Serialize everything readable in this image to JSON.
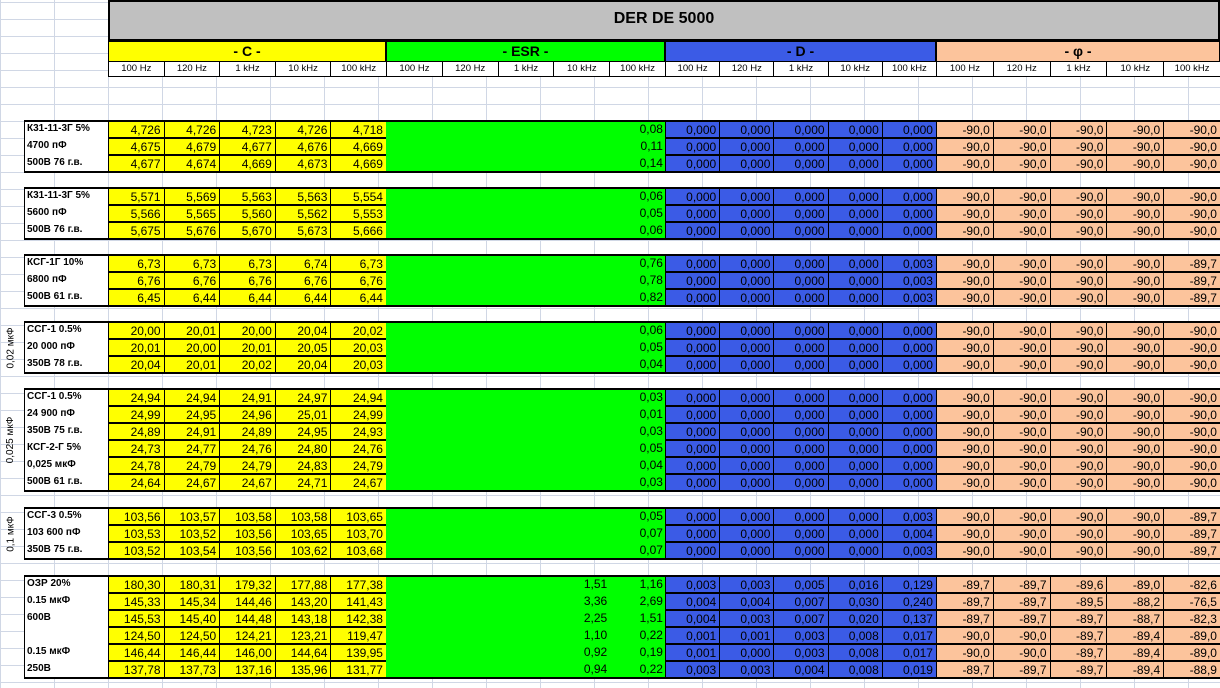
{
  "title": "DER DE 5000",
  "groups": [
    {
      "name": "- C -",
      "color": "#ffff00"
    },
    {
      "name": "- ESR -",
      "color": "#00ff00"
    },
    {
      "name": "- D -",
      "color": "#3b5be6"
    },
    {
      "name": "- φ -",
      "color": "#fcc49c"
    }
  ],
  "frequencies": [
    "100 Hz",
    "120 Hz",
    "1 kHz",
    "10 kHz",
    "100 kHz"
  ],
  "side_labels": [
    "0,02 мкФ",
    "0,025 мкФ",
    "0,1 мкФ"
  ],
  "rows": [
    {
      "label": "К31-11-3Г 5%",
      "c": [
        "4,726",
        "4,726",
        "4,723",
        "4,726",
        "4,718"
      ],
      "esr": [
        "",
        "",
        "",
        "",
        "0,08"
      ],
      "d": [
        "0,000",
        "0,000",
        "0,000",
        "0,000",
        "0,000"
      ],
      "phi": [
        "-90,0",
        "-90,0",
        "-90,0",
        "-90,0",
        "-90,0"
      ]
    },
    {
      "label": "4700 пФ",
      "c": [
        "4,675",
        "4,679",
        "4,677",
        "4,676",
        "4,669"
      ],
      "esr": [
        "",
        "",
        "",
        "",
        "0,11"
      ],
      "d": [
        "0,000",
        "0,000",
        "0,000",
        "0,000",
        "0,000"
      ],
      "phi": [
        "-90,0",
        "-90,0",
        "-90,0",
        "-90,0",
        "-90,0"
      ]
    },
    {
      "label": "500В 76 г.в.",
      "c": [
        "4,677",
        "4,674",
        "4,669",
        "4,673",
        "4,669"
      ],
      "esr": [
        "",
        "",
        "",
        "",
        "0,14"
      ],
      "d": [
        "0,000",
        "0,000",
        "0,000",
        "0,000",
        "0,000"
      ],
      "phi": [
        "-90,0",
        "-90,0",
        "-90,0",
        "-90,0",
        "-90,0"
      ]
    },
    {
      "label": "К31-11-3Г 5%",
      "c": [
        "5,571",
        "5,569",
        "5,563",
        "5,563",
        "5,554"
      ],
      "esr": [
        "",
        "",
        "",
        "",
        "0,06"
      ],
      "d": [
        "0,000",
        "0,000",
        "0,000",
        "0,000",
        "0,000"
      ],
      "phi": [
        "-90,0",
        "-90,0",
        "-90,0",
        "-90,0",
        "-90,0"
      ]
    },
    {
      "label": "5600 пФ",
      "c": [
        "5,566",
        "5,565",
        "5,560",
        "5,562",
        "5,553"
      ],
      "esr": [
        "",
        "",
        "",
        "",
        "0,05"
      ],
      "d": [
        "0,000",
        "0,000",
        "0,000",
        "0,000",
        "0,000"
      ],
      "phi": [
        "-90,0",
        "-90,0",
        "-90,0",
        "-90,0",
        "-90,0"
      ]
    },
    {
      "label": "500В 76 г.в.",
      "c": [
        "5,675",
        "5,676",
        "5,670",
        "5,673",
        "5,666"
      ],
      "esr": [
        "",
        "",
        "",
        "",
        "0,06"
      ],
      "d": [
        "0,000",
        "0,000",
        "0,000",
        "0,000",
        "0,000"
      ],
      "phi": [
        "-90,0",
        "-90,0",
        "-90,0",
        "-90,0",
        "-90,0"
      ]
    },
    {
      "label": "КСГ-1Г 10%",
      "c": [
        "6,73",
        "6,73",
        "6,73",
        "6,74",
        "6,73"
      ],
      "esr": [
        "",
        "",
        "",
        "",
        "0,76"
      ],
      "d": [
        "0,000",
        "0,000",
        "0,000",
        "0,000",
        "0,003"
      ],
      "phi": [
        "-90,0",
        "-90,0",
        "-90,0",
        "-90,0",
        "-89,7"
      ]
    },
    {
      "label": "6800 пФ",
      "c": [
        "6,76",
        "6,76",
        "6,76",
        "6,76",
        "6,76"
      ],
      "esr": [
        "",
        "",
        "",
        "",
        "0,78"
      ],
      "d": [
        "0,000",
        "0,000",
        "0,000",
        "0,000",
        "0,003"
      ],
      "phi": [
        "-90,0",
        "-90,0",
        "-90,0",
        "-90,0",
        "-89,7"
      ]
    },
    {
      "label": "500В 61 г.в.",
      "c": [
        "6,45",
        "6,44",
        "6,44",
        "6,44",
        "6,44"
      ],
      "esr": [
        "",
        "",
        "",
        "",
        "0,82"
      ],
      "d": [
        "0,000",
        "0,000",
        "0,000",
        "0,000",
        "0,003"
      ],
      "phi": [
        "-90,0",
        "-90,0",
        "-90,0",
        "-90,0",
        "-89,7"
      ]
    },
    {
      "label": "ССГ-1 0.5%",
      "c": [
        "20,00",
        "20,01",
        "20,00",
        "20,04",
        "20,02"
      ],
      "esr": [
        "",
        "",
        "",
        "",
        "0,06"
      ],
      "d": [
        "0,000",
        "0,000",
        "0,000",
        "0,000",
        "0,000"
      ],
      "phi": [
        "-90,0",
        "-90,0",
        "-90,0",
        "-90,0",
        "-90,0"
      ]
    },
    {
      "label": "20 000 пФ",
      "c": [
        "20,01",
        "20,00",
        "20,01",
        "20,05",
        "20,03"
      ],
      "esr": [
        "",
        "",
        "",
        "",
        "0,05"
      ],
      "d": [
        "0,000",
        "0,000",
        "0,000",
        "0,000",
        "0,000"
      ],
      "phi": [
        "-90,0",
        "-90,0",
        "-90,0",
        "-90,0",
        "-90,0"
      ]
    },
    {
      "label": "350В 78 г.в.",
      "c": [
        "20,04",
        "20,01",
        "20,02",
        "20,04",
        "20,03"
      ],
      "esr": [
        "",
        "",
        "",
        "",
        "0,04"
      ],
      "d": [
        "0,000",
        "0,000",
        "0,000",
        "0,000",
        "0,000"
      ],
      "phi": [
        "-90,0",
        "-90,0",
        "-90,0",
        "-90,0",
        "-90,0"
      ]
    },
    {
      "label": "ССГ-1 0.5%",
      "c": [
        "24,94",
        "24,94",
        "24,91",
        "24,97",
        "24,94"
      ],
      "esr": [
        "",
        "",
        "",
        "",
        "0,03"
      ],
      "d": [
        "0,000",
        "0,000",
        "0,000",
        "0,000",
        "0,000"
      ],
      "phi": [
        "-90,0",
        "-90,0",
        "-90,0",
        "-90,0",
        "-90,0"
      ]
    },
    {
      "label": "24 900 пФ",
      "c": [
        "24,99",
        "24,95",
        "24,96",
        "25,01",
        "24,99"
      ],
      "esr": [
        "",
        "",
        "",
        "",
        "0,01"
      ],
      "d": [
        "0,000",
        "0,000",
        "0,000",
        "0,000",
        "0,000"
      ],
      "phi": [
        "-90,0",
        "-90,0",
        "-90,0",
        "-90,0",
        "-90,0"
      ]
    },
    {
      "label": "350В 75 г.в.",
      "c": [
        "24,89",
        "24,91",
        "24,89",
        "24,95",
        "24,93"
      ],
      "esr": [
        "",
        "",
        "",
        "",
        "0,03"
      ],
      "d": [
        "0,000",
        "0,000",
        "0,000",
        "0,000",
        "0,000"
      ],
      "phi": [
        "-90,0",
        "-90,0",
        "-90,0",
        "-90,0",
        "-90,0"
      ]
    },
    {
      "label": "КСГ-2-Г 5%",
      "c": [
        "24,73",
        "24,77",
        "24,76",
        "24,80",
        "24,76"
      ],
      "esr": [
        "",
        "",
        "",
        "",
        "0,05"
      ],
      "d": [
        "0,000",
        "0,000",
        "0,000",
        "0,000",
        "0,000"
      ],
      "phi": [
        "-90,0",
        "-90,0",
        "-90,0",
        "-90,0",
        "-90,0"
      ]
    },
    {
      "label": "0,025 мкФ",
      "c": [
        "24,78",
        "24,79",
        "24,79",
        "24,83",
        "24,79"
      ],
      "esr": [
        "",
        "",
        "",
        "",
        "0,04"
      ],
      "d": [
        "0,000",
        "0,000",
        "0,000",
        "0,000",
        "0,000"
      ],
      "phi": [
        "-90,0",
        "-90,0",
        "-90,0",
        "-90,0",
        "-90,0"
      ]
    },
    {
      "label": "500В 61 г.в.",
      "c": [
        "24,64",
        "24,67",
        "24,67",
        "24,71",
        "24,67"
      ],
      "esr": [
        "",
        "",
        "",
        "",
        "0,03"
      ],
      "d": [
        "0,000",
        "0,000",
        "0,000",
        "0,000",
        "0,000"
      ],
      "phi": [
        "-90,0",
        "-90,0",
        "-90,0",
        "-90,0",
        "-90,0"
      ]
    },
    {
      "label": "ССГ-3 0.5%",
      "c": [
        "103,56",
        "103,57",
        "103,58",
        "103,58",
        "103,65"
      ],
      "esr": [
        "",
        "",
        "",
        "",
        "0,05"
      ],
      "d": [
        "0,000",
        "0,000",
        "0,000",
        "0,000",
        "0,003"
      ],
      "phi": [
        "-90,0",
        "-90,0",
        "-90,0",
        "-90,0",
        "-89,7"
      ]
    },
    {
      "label": "103 600 пФ",
      "c": [
        "103,53",
        "103,52",
        "103,56",
        "103,65",
        "103,70"
      ],
      "esr": [
        "",
        "",
        "",
        "",
        "0,07"
      ],
      "d": [
        "0,000",
        "0,000",
        "0,000",
        "0,000",
        "0,004"
      ],
      "phi": [
        "-90,0",
        "-90,0",
        "-90,0",
        "-90,0",
        "-89,7"
      ]
    },
    {
      "label": "350В 75 г.в.",
      "c": [
        "103,52",
        "103,54",
        "103,56",
        "103,62",
        "103,68"
      ],
      "esr": [
        "",
        "",
        "",
        "",
        "0,07"
      ],
      "d": [
        "0,000",
        "0,000",
        "0,000",
        "0,000",
        "0,003"
      ],
      "phi": [
        "-90,0",
        "-90,0",
        "-90,0",
        "-90,0",
        "-89,7"
      ]
    },
    {
      "label": "ОЗР 20%",
      "c": [
        "180,30",
        "180,31",
        "179,32",
        "177,88",
        "177,38"
      ],
      "esr": [
        "",
        "",
        "",
        "1,51",
        "1,16"
      ],
      "d": [
        "0,003",
        "0,003",
        "0,005",
        "0,016",
        "0,129"
      ],
      "phi": [
        "-89,7",
        "-89,7",
        "-89,6",
        "-89,0",
        "-82,6"
      ]
    },
    {
      "label": "0.15 мкФ",
      "c": [
        "145,33",
        "145,34",
        "144,46",
        "143,20",
        "141,43"
      ],
      "esr": [
        "",
        "",
        "",
        "3,36",
        "2,69"
      ],
      "d": [
        "0,004",
        "0,004",
        "0,007",
        "0,030",
        "0,240"
      ],
      "phi": [
        "-89,7",
        "-89,7",
        "-89,5",
        "-88,2",
        "-76,5"
      ]
    },
    {
      "label": "600В",
      "c": [
        "145,53",
        "145,40",
        "144,48",
        "143,18",
        "142,38"
      ],
      "esr": [
        "",
        "",
        "",
        "2,25",
        "1,51"
      ],
      "d": [
        "0,004",
        "0,003",
        "0,007",
        "0,020",
        "0,137"
      ],
      "phi": [
        "-89,7",
        "-89,7",
        "-89,7",
        "-88,7",
        "-82,3"
      ]
    },
    {
      "label": "",
      "c": [
        "124,50",
        "124,50",
        "124,21",
        "123,21",
        "119,47"
      ],
      "esr": [
        "",
        "",
        "",
        "1,10",
        "0,22"
      ],
      "d": [
        "0,001",
        "0,001",
        "0,003",
        "0,008",
        "0,017"
      ],
      "phi": [
        "-90,0",
        "-90,0",
        "-89,7",
        "-89,4",
        "-89,0"
      ]
    },
    {
      "label": "0.15 мкФ",
      "c": [
        "146,44",
        "146,44",
        "146,00",
        "144,64",
        "139,95"
      ],
      "esr": [
        "",
        "",
        "",
        "0,92",
        "0,19"
      ],
      "d": [
        "0,001",
        "0,000",
        "0,003",
        "0,008",
        "0,017"
      ],
      "phi": [
        "-90,0",
        "-90,0",
        "-89,7",
        "-89,4",
        "-89,0"
      ]
    },
    {
      "label": "250В",
      "c": [
        "137,78",
        "137,73",
        "137,16",
        "135,96",
        "131,77"
      ],
      "esr": [
        "",
        "",
        "",
        "0,94",
        "0,22"
      ],
      "d": [
        "0,003",
        "0,003",
        "0,004",
        "0,008",
        "0,019"
      ],
      "phi": [
        "-89,7",
        "-89,7",
        "-89,7",
        "-89,4",
        "-88,9"
      ]
    }
  ]
}
